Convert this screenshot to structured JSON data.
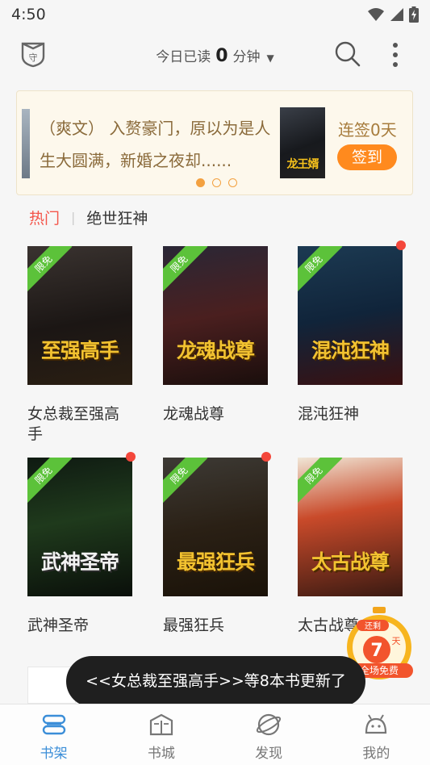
{
  "status_bar": {
    "time": "4:50"
  },
  "header": {
    "reading_prefix": "今日已读",
    "reading_value": "0",
    "reading_unit": "分钟"
  },
  "banner": {
    "text": "（爽文） 入赘豪门，原以为是人生大圆满，新婚之夜却......",
    "cover_text": "龙王婿",
    "streak": "连签0天",
    "signin_label": "签到",
    "carousel_index": 1,
    "carousel_count": 3
  },
  "tags": {
    "hot": "热门",
    "current": "绝世狂神"
  },
  "books": [
    {
      "title": "女总裁至强高手",
      "cover_text": "至强高手",
      "badge": "限免",
      "has_update_dot": false
    },
    {
      "title": "龙魂战尊",
      "cover_text": "龙魂战尊",
      "badge": "限免",
      "has_update_dot": false
    },
    {
      "title": "混沌狂神",
      "cover_text": "混沌狂神",
      "badge": "限免",
      "has_update_dot": true
    },
    {
      "title": "武神圣帝",
      "cover_text": "武神圣帝",
      "badge": "限免",
      "has_update_dot": true
    },
    {
      "title": "最强狂兵",
      "cover_text": "最强狂兵",
      "badge": "限免",
      "has_update_dot": true
    },
    {
      "title": "太古战尊",
      "cover_text": "太古战尊",
      "badge": "限免",
      "has_update_dot": false
    }
  ],
  "promo_badge": {
    "line1": "还剩",
    "days": "7",
    "day_unit": "天",
    "line2": "全场免费"
  },
  "toast": "<<女总裁至强高手>>等8本书更新了",
  "bottom_nav": [
    {
      "label": "书架",
      "icon": "bookshelf-icon",
      "active": true
    },
    {
      "label": "书城",
      "icon": "bookstore-icon",
      "active": false
    },
    {
      "label": "发现",
      "icon": "planet-icon",
      "active": false
    },
    {
      "label": "我的",
      "icon": "profile-icon",
      "active": false
    }
  ],
  "colors": {
    "accent_orange": "#ff8a1e",
    "hot_red": "#f4554a",
    "nav_active": "#3b8ed8",
    "ribbon_green": "#5cc23a"
  }
}
